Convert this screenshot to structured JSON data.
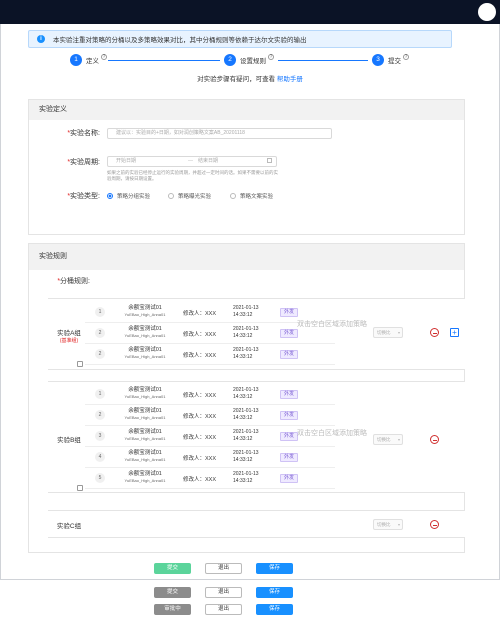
{
  "notice": "本实验注重对策略的分桶以及多策略效果对比，其中分桶规则等依赖于达尔文实验的输出",
  "steps": [
    {
      "num": "1",
      "label": "定义"
    },
    {
      "num": "2",
      "label": "设置规则"
    },
    {
      "num": "3",
      "label": "提交"
    }
  ],
  "help_text": "对实验步骤有疑问，可查看",
  "help_link": "帮助手册",
  "definition": {
    "title": "实验定义",
    "name_label": "实验名称:",
    "name_placeholder": "建议以：实验目的+日期，如对润创策略文案AB_20201118",
    "period_label": "实验周期:",
    "start_placeholder": "开始日期",
    "end_placeholder": "结束日期",
    "period_hint": "如果之前的实验已经停止运行的实验周期，并超过一定时间的话。如果不需要以前的实验周期，请按日期设置。",
    "type_label": "实验类型:",
    "types": [
      "策略分组实验",
      "策略曝光实验",
      "策略文案实验"
    ]
  },
  "rules": {
    "title": "实验规则",
    "bucket_label": "分桶规则:",
    "blank_text": "双击空白区域添加策略",
    "side_placeholder": "切换比",
    "groups": [
      {
        "name": "实验A组",
        "sub": "(基准组)",
        "strategies": [
          {
            "num": "1",
            "name": "余额宝测试01",
            "code": "YuEBao_High_Anna01",
            "modifier": "修改人：XXX",
            "date": "2021-01-13",
            "time": "14:33:12",
            "tag": "外发"
          },
          {
            "num": "2",
            "name": "余额宝测试01",
            "code": "YuEBao_High_Anna01",
            "modifier": "修改人：XXX",
            "date": "2021-01-13",
            "time": "14:33:12",
            "tag": "外发"
          },
          {
            "num": "2",
            "name": "余额宝测试01",
            "code": "YuEBao_High_Anna01",
            "modifier": "修改人：XXX",
            "date": "2021-01-13",
            "time": "14:33:12",
            "tag": "外发"
          }
        ]
      },
      {
        "name": "实验B组",
        "sub": "",
        "strategies": [
          {
            "num": "1",
            "name": "余额宝测试01",
            "code": "YuEBao_High_Anna01",
            "modifier": "修改人：XXX",
            "date": "2021-01-13",
            "time": "14:33:12",
            "tag": "外发"
          },
          {
            "num": "2",
            "name": "余额宝测试01",
            "code": "YuEBao_High_Anna01",
            "modifier": "修改人：XXX",
            "date": "2021-01-13",
            "time": "14:33:12",
            "tag": "外发"
          },
          {
            "num": "3",
            "name": "余额宝测试01",
            "code": "YuEBao_High_Anna01",
            "modifier": "修改人：XXX",
            "date": "2021-01-13",
            "time": "14:33:12",
            "tag": "外发"
          },
          {
            "num": "4",
            "name": "余额宝测试01",
            "code": "YuEBao_High_Anna01",
            "modifier": "修改人：XXX",
            "date": "2021-01-13",
            "time": "14:33:12",
            "tag": "外发"
          },
          {
            "num": "5",
            "name": "余额宝测试01",
            "code": "YuEBao_High_Anna01",
            "modifier": "修改人：XXX",
            "date": "2021-01-13",
            "time": "14:33:12",
            "tag": "外发"
          }
        ]
      },
      {
        "name": "实验C组",
        "sub": "",
        "strategies": []
      }
    ]
  },
  "actions_row1": [
    "提交",
    "退出",
    "保存"
  ],
  "actions_row2": [
    "提交",
    "退出",
    "保存"
  ],
  "actions_row3": [
    "审批中",
    "退出",
    "保存"
  ],
  "colors": {
    "primary": "#1677ff",
    "topbar": "#0b1326",
    "danger": "#d03030",
    "success": "#5bd49b"
  }
}
